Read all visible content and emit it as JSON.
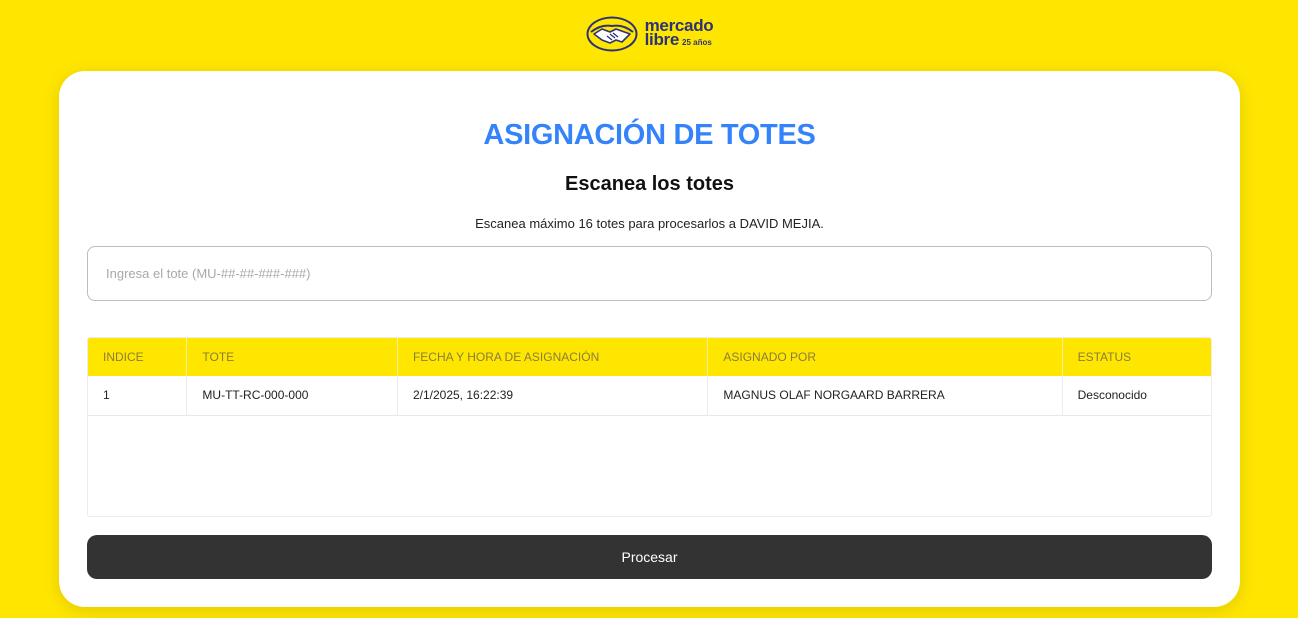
{
  "header": {
    "logo": {
      "word1": "mercado",
      "word2": "libre",
      "years": "25 años",
      "colors": {
        "body": "#ffe600",
        "outline": "#2d3277",
        "hands": "#ffffff"
      }
    }
  },
  "main": {
    "title": "ASIGNACIÓN DE TOTES",
    "subtitle": "Escanea los totes",
    "description": "Escanea máximo 16 totes para procesarlos a DAVID MEJIA.",
    "tote_input": {
      "placeholder": "Ingresa el tote (MU-##-##-###-###)",
      "value": ""
    },
    "table": {
      "columns": [
        "INDICE",
        "TOTE",
        "FECHA Y HORA DE ASIGNACIÓN",
        "ASIGNADO POR",
        "ESTATUS"
      ],
      "rows": [
        {
          "indice": "1",
          "tote": "MU-TT-RC-000-000",
          "fecha": "2/1/2025, 16:22:39",
          "asignado_por": "MAGNUS OLAF NORGAARD BARRERA",
          "estatus": "Desconocido"
        }
      ]
    },
    "process_button": {
      "label": "Procesar"
    }
  },
  "colors": {
    "page_background": "#ffe600",
    "title": "#3483fa",
    "table_header": "#ffe600",
    "button": "#333333"
  }
}
